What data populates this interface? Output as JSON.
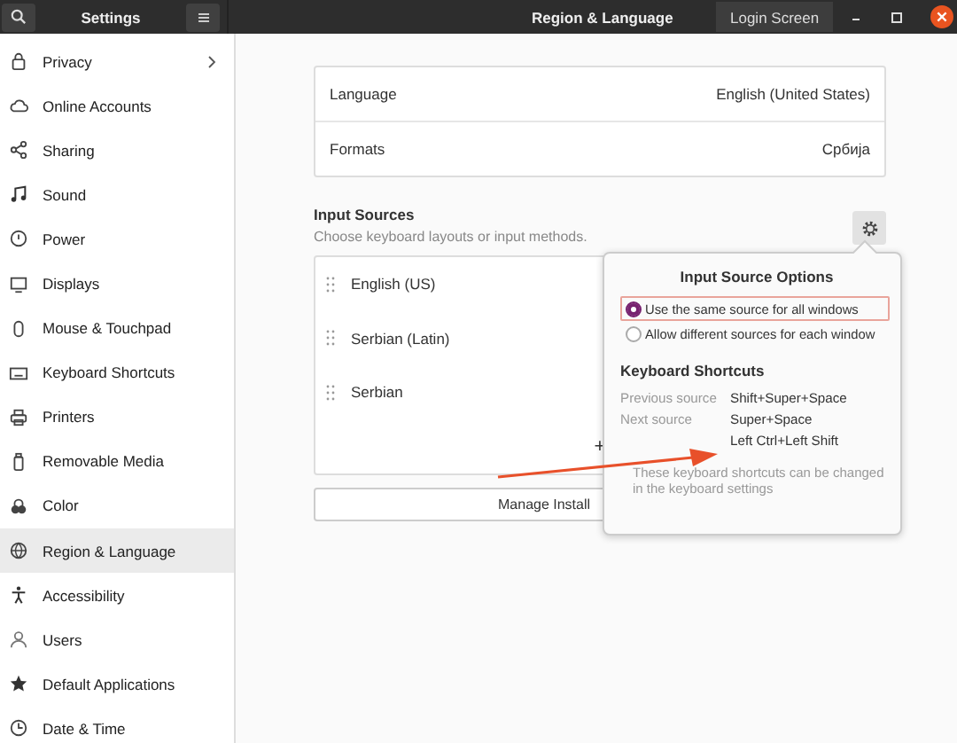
{
  "header": {
    "app_title": "Settings",
    "page_title": "Region & Language",
    "login_button": "Login Screen"
  },
  "sidebar": {
    "items": [
      {
        "label": "Privacy",
        "selected": false,
        "has_chevron": true
      },
      {
        "label": "Online Accounts",
        "selected": false
      },
      {
        "label": "Sharing",
        "selected": false
      },
      {
        "label": "Sound",
        "selected": false
      },
      {
        "label": "Power",
        "selected": false
      },
      {
        "label": "Displays",
        "selected": false
      },
      {
        "label": "Mouse & Touchpad",
        "selected": false
      },
      {
        "label": "Keyboard Shortcuts",
        "selected": false
      },
      {
        "label": "Printers",
        "selected": false
      },
      {
        "label": "Removable Media",
        "selected": false
      },
      {
        "label": "Color",
        "selected": false
      },
      {
        "label": "Region & Language",
        "selected": true
      },
      {
        "label": "Accessibility",
        "selected": false
      },
      {
        "label": "Users",
        "selected": false
      },
      {
        "label": "Default Applications",
        "selected": false
      },
      {
        "label": "Date & Time",
        "selected": false
      }
    ]
  },
  "language_settings": [
    {
      "label": "Language",
      "value": "English (United States)"
    },
    {
      "label": "Formats",
      "value": "Србија"
    }
  ],
  "input_sources": {
    "title": "Input Sources",
    "subtitle": "Choose keyboard layouts or input methods.",
    "sources": [
      "English (US)",
      "Serbian (Latin)",
      "Serbian"
    ],
    "add_button": "+",
    "manage_button": "Manage Install"
  },
  "popover": {
    "title": "Input Source Options",
    "options": [
      {
        "label": "Use the same source for all windows",
        "selected": true
      },
      {
        "label": "Allow different sources for each window",
        "selected": false
      }
    ],
    "shortcuts_title": "Keyboard Shortcuts",
    "shortcuts": [
      {
        "label": "Previous source",
        "value": "Shift+Super+Space"
      },
      {
        "label": "Next source",
        "value": "Super+Space"
      },
      {
        "value": "Left Ctrl+Left Shift"
      }
    ],
    "note": "These keyboard shortcuts can be changed in the keyboard settings"
  }
}
